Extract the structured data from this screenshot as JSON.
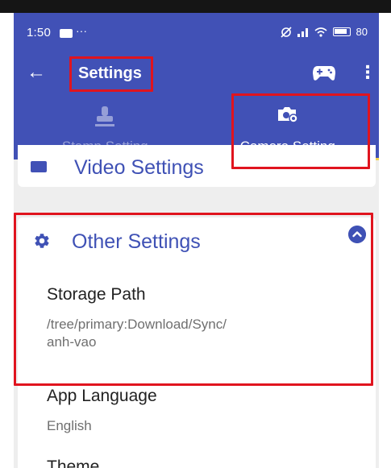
{
  "status_bar": {
    "time": "1:50",
    "more": "···",
    "battery": "80"
  },
  "toolbar": {
    "title": "Settings"
  },
  "tabs": [
    {
      "label": "Stamp Setting",
      "active": false
    },
    {
      "label": "Camera Setting",
      "active": true
    }
  ],
  "sections": {
    "video": {
      "title": "Video Settings"
    },
    "other": {
      "title": "Other Settings",
      "items": [
        {
          "title": "Storage Path",
          "value": "/tree/primary:Download/Sync/\nanh-vao"
        },
        {
          "title": "App Language",
          "value": "English"
        },
        {
          "title": "Theme"
        }
      ]
    }
  },
  "colors": {
    "primary": "#4151b6",
    "accent_text": "#3f51b5",
    "tab_indicator": "#f4d24c",
    "highlight": "#e0141e",
    "background": "#eeeeee"
  },
  "icons": {
    "back": "arrow-left-icon",
    "gamepad": "gamepad-icon",
    "more": "more-vert-icon",
    "stamp": "stamp-icon",
    "camera": "camera-settings-icon",
    "video": "video-icon",
    "gear": "gear-icon",
    "collapse": "chevron-up-icon"
  }
}
